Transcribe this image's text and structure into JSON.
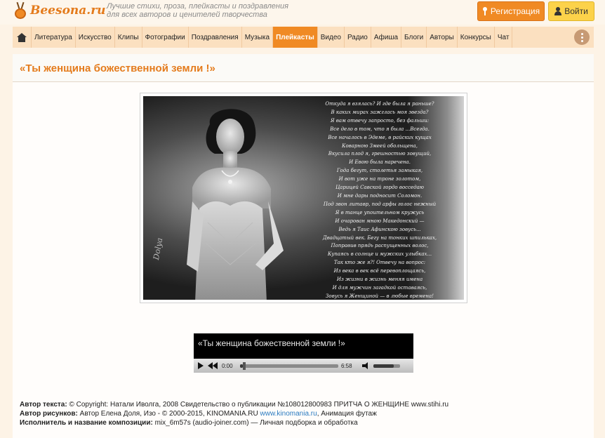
{
  "header": {
    "logo_text": "Beesona.ru",
    "tagline_line1": "Лучшие стихи, проза, плейкасты и поздравления",
    "tagline_line2": "для всех авторов и ценителей творчества",
    "register_label": "Регистрация",
    "login_label": "Войти"
  },
  "nav": {
    "items": [
      {
        "label": "Литература"
      },
      {
        "label": "Искусство"
      },
      {
        "label": "Клипы"
      },
      {
        "label": "Фотографии"
      },
      {
        "label": "Поздравления"
      },
      {
        "label": "Музыка"
      },
      {
        "label": "Плейкасты",
        "active": true
      },
      {
        "label": "Видео"
      },
      {
        "label": "Радио"
      },
      {
        "label": "Афиша"
      },
      {
        "label": "Блоги"
      },
      {
        "label": "Авторы"
      },
      {
        "label": "Конкурсы"
      },
      {
        "label": "Чат"
      }
    ]
  },
  "page": {
    "title": "«Ты женщина божественной земли !»"
  },
  "poem": {
    "lines": [
      "Откуда я взялась? И где была я раньше?",
      "В каких мирах зажглась моя звезда?",
      "Я вам отвечу запросто, без фальши:",
      "Все дело в том, что я была ...Всегда.",
      "Все началось в Эдеме, в райских кущах",
      "Коварною Змеей обольщена,",
      "Вкусила плод я, грешностью зовущий,",
      "И Евою была наречена.",
      "Года бегут, столетья замыкая,",
      "И вот уже на троне золотом,",
      "Царицей Савской гордо восседаю",
      "И мне дары подносит Соломон.",
      "Под звон литавр, под арфы голос нежный",
      "Я в танце упоительном кружусь",
      "И очарован мною Македонский —",
      "Ведь я Таис Афинскою зовусь...",
      "Двадцатый век. Бегу на тонких шпильках,",
      "Поправив прядь распущенных волос,",
      "Купаясь в солнце и мужских улыбках...",
      "Так кто же я?! Отвечу на вопрос:",
      "Из века в век всё перевоплощаясь,",
      "Из жизни в жизнь меняя имена",
      "И для мужчин загадкой оставаясь,",
      "Зовусь я Женщиной — в любые времена!"
    ],
    "signature": "Dolya"
  },
  "player": {
    "title": "«Ты женщина божественной земли !»",
    "current_time": "0:00",
    "duration": "6:58",
    "progress": 0.03,
    "volume": 0.75
  },
  "credits": {
    "text_author_label": "Автор текста:",
    "text_author_value": "© Copyright: Натали Иволга, 2008 Свидетельство о публикации №108012800983 ПРИТЧА О ЖЕНЩИНЕ www.stihi.ru",
    "pictures_author_label": "Автор рисунков:",
    "pictures_author_value": "Автор Елена Доля, Изо - © 2000-2015, KINOMANIA.RU",
    "pictures_author_link": "www.kinomania.ru",
    "pictures_author_suffix": ", Анимация футаж",
    "performer_label": "Исполнитель и название композиции:",
    "performer_value": "mix_6m57s (audio-joiner.com) — Личная подборка и обработка"
  },
  "colors": {
    "accent": "#f08a24",
    "title": "#e47b1c",
    "login": "#fcd24a",
    "nav_bg": "#fbe0c0",
    "link": "#2b7bc0"
  }
}
